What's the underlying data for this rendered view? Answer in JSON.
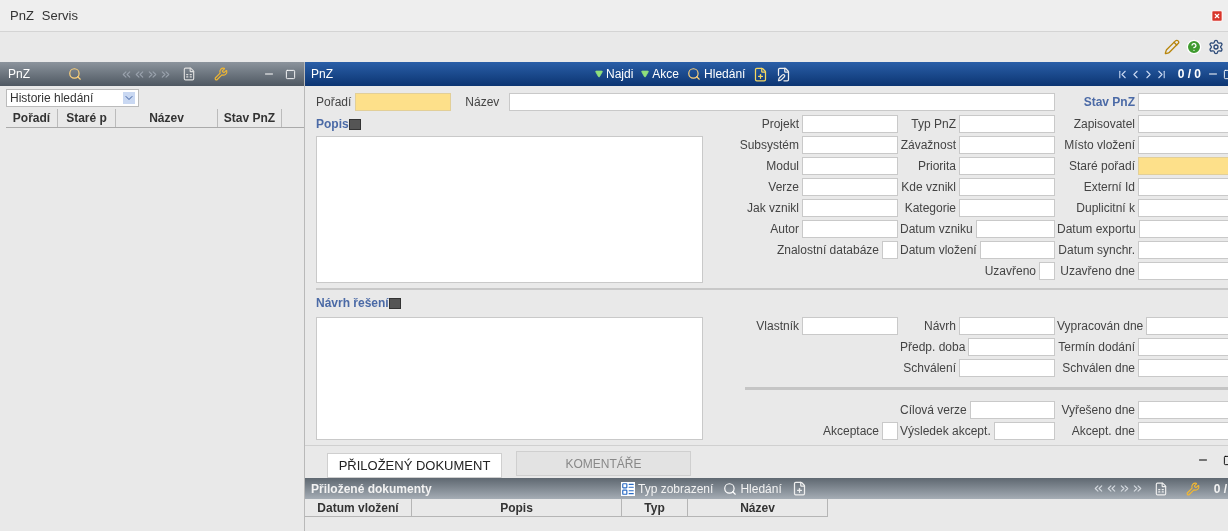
{
  "menu": [
    {
      "label": "PnZ"
    },
    {
      "label": "Servis"
    }
  ],
  "left_panel": {
    "title": "PnZ",
    "history_select": {
      "value": "Historie hledání"
    },
    "columns": [
      "Pořadí",
      "Staré p",
      "Název",
      "Stav PnZ"
    ]
  },
  "main_panel": {
    "title": "PnZ",
    "actions": [
      {
        "label": "Najdi",
        "kind": "menu"
      },
      {
        "label": "Akce",
        "kind": "menu"
      },
      {
        "label": "Hledání",
        "kind": "search"
      }
    ],
    "counter": "0 / 0",
    "header_fields": [
      {
        "label": "Pořadí",
        "kind": "key",
        "emphasized": false
      },
      {
        "label": "Název",
        "kind": "text",
        "emphasized": false
      },
      {
        "label": "Stav PnZ",
        "kind": "text",
        "emphasized": true
      }
    ],
    "description": {
      "label": "Popis"
    },
    "fields": [
      {
        "first": {
          "label": "Projekt",
          "kind": "text"
        },
        "second": {
          "label": "Typ PnZ",
          "kind": "text"
        },
        "third": {
          "label": "Zapisovatel",
          "kind": "text"
        }
      },
      {
        "first": {
          "label": "Subsystém",
          "kind": "text"
        },
        "second": {
          "label": "Závažnost",
          "kind": "text"
        },
        "third": {
          "label": "Místo vložení",
          "kind": "text"
        }
      },
      {
        "first": {
          "label": "Modul",
          "kind": "text"
        },
        "second": {
          "label": "Priorita",
          "kind": "text"
        },
        "third": {
          "label": "Staré pořadí",
          "kind": "key"
        }
      },
      {
        "first": {
          "label": "Verze",
          "kind": "text"
        },
        "second": {
          "label": "Kde vznikl",
          "kind": "text"
        },
        "third": {
          "label": "Externí Id",
          "kind": "text"
        }
      },
      {
        "first": {
          "label": "Jak vznikl",
          "kind": "text"
        },
        "second": {
          "label": "Kategorie",
          "kind": "text"
        },
        "third": {
          "label": "Duplicitní k",
          "kind": "text"
        }
      },
      {
        "first": {
          "label": "Autor",
          "kind": "text"
        },
        "second": {
          "label": "Datum vzniku",
          "kind": "text"
        },
        "third": {
          "label": "Datum exportu",
          "kind": "text"
        }
      },
      {
        "first": {
          "label": "Znalostní databáze",
          "kind": "check",
          "checked": false
        },
        "second": {
          "label": "Datum vložení",
          "kind": "text"
        },
        "third": {
          "label": "Datum synchr.",
          "kind": "text"
        }
      },
      {
        "second": {
          "label": "Uzavřeno",
          "kind": "check",
          "checked": false
        },
        "third": {
          "label": "Uzavřeno dne",
          "kind": "text"
        }
      }
    ],
    "solution": {
      "label": "Návrh řešení"
    },
    "solution_fields": [
      {
        "first": {
          "label": "Vlastník",
          "kind": "text"
        },
        "second": {
          "label": "Návrh",
          "kind": "text"
        },
        "third": {
          "label": "Vypracován dne",
          "kind": "text"
        }
      },
      {
        "second": {
          "label": "Předp. doba",
          "kind": "text"
        },
        "third": {
          "label": "Termín dodání",
          "kind": "text"
        }
      },
      {
        "second": {
          "label": "Schválení",
          "kind": "text"
        },
        "third": {
          "label": "Schválen dne",
          "kind": "text"
        }
      }
    ],
    "result_fields": [
      {
        "second": {
          "label": "Cílová verze",
          "kind": "text"
        },
        "third": {
          "label": "Vyřešeno dne",
          "kind": "text"
        }
      },
      {
        "first": {
          "label": "Akceptace",
          "kind": "check",
          "checked": false
        },
        "second": {
          "label": "Výsledek akcept.",
          "kind": "text"
        },
        "third": {
          "label": "Akcept. dne",
          "kind": "text"
        }
      }
    ]
  },
  "attachments": {
    "tabs": [
      {
        "label": "PŘILOŽENÝ DOKUMENT",
        "selected": true
      },
      {
        "label": "KOMENTÁŘE",
        "selected": false
      }
    ],
    "title": "Přiložené dokumenty",
    "actions": [
      {
        "label": "Typ zobrazení",
        "kind": "view"
      },
      {
        "label": "Hledání",
        "kind": "search"
      }
    ],
    "counter": "0 /",
    "columns": [
      "Datum vložení",
      "Popis",
      "Typ",
      "Název"
    ]
  }
}
